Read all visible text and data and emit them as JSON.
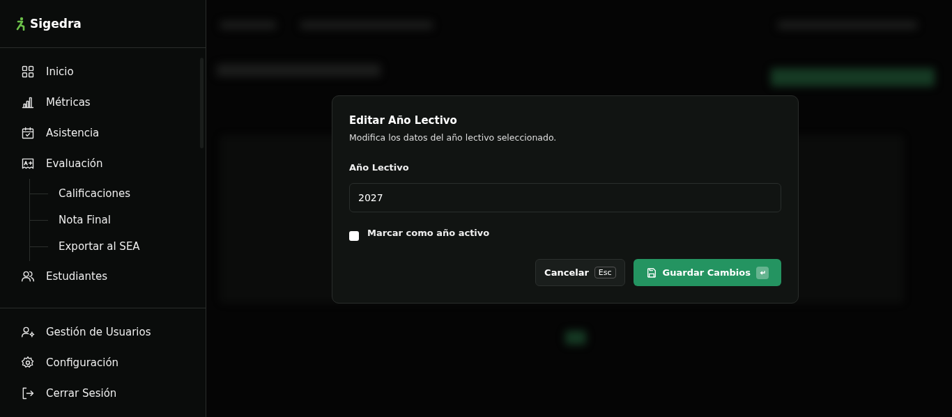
{
  "sidebar": {
    "brand": "Sigedra",
    "items": [
      {
        "label": "Inicio"
      },
      {
        "label": "Métricas"
      },
      {
        "label": "Asistencia"
      },
      {
        "label": "Evaluación",
        "children": [
          {
            "label": "Calificaciones"
          },
          {
            "label": "Nota Final"
          },
          {
            "label": "Exportar al SEA"
          }
        ]
      },
      {
        "label": "Estudiantes"
      }
    ],
    "footer_items": [
      {
        "label": "Gestión de Usuarios"
      },
      {
        "label": "Configuración"
      },
      {
        "label": "Cerrar Sesión"
      }
    ]
  },
  "dialog": {
    "title": "Editar Año Lectivo",
    "description": "Modifica los datos del año lectivo seleccionado.",
    "field": {
      "label": "Año Lectivo",
      "value": "2027"
    },
    "checkbox": {
      "label": "Marcar como año activo",
      "checked": false
    },
    "cancel": {
      "label": "Cancelar",
      "shortcut": "Esc"
    },
    "save": {
      "label": "Guardar Cambios"
    }
  }
}
